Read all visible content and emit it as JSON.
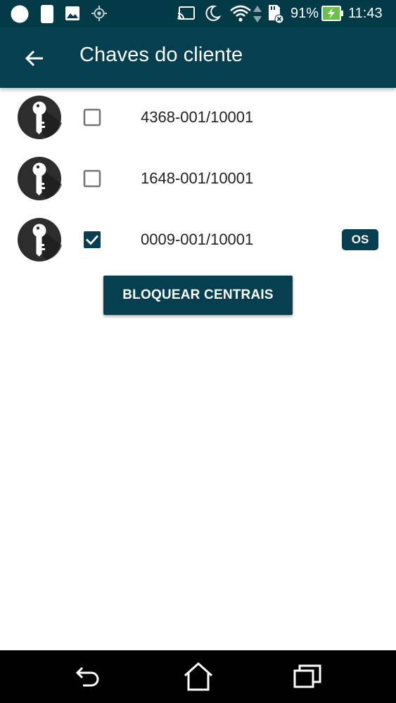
{
  "status_bar": {
    "battery_percent": "91%",
    "time": "11:43",
    "icons": [
      "notification-dot-icon",
      "sim-card-icon",
      "image-icon",
      "gps-icon",
      "cast-icon",
      "moon-icon",
      "wifi-icon",
      "data-arrows-icon",
      "sd-card-icon",
      "battery-charging-icon"
    ]
  },
  "app_bar": {
    "title": "Chaves do cliente",
    "back_icon": "arrow-left-icon",
    "background": "#063f4f"
  },
  "keys": [
    {
      "code": "4368-001/10001",
      "checked": false,
      "badge": ""
    },
    {
      "code": "1648-001/10001",
      "checked": false,
      "badge": ""
    },
    {
      "code": "0009-001/10001",
      "checked": true,
      "badge": "OS"
    }
  ],
  "action": {
    "label": "BLOQUEAR CENTRAIS"
  },
  "nav_bar": {
    "icons": [
      "back-icon",
      "home-icon",
      "recent-apps-icon"
    ]
  },
  "colors": {
    "primary": "#063f4f",
    "status_bar": "#023a47",
    "text": "#222222",
    "checkbox_unchecked": "#757575",
    "battery_charging": "#6cc04a"
  }
}
